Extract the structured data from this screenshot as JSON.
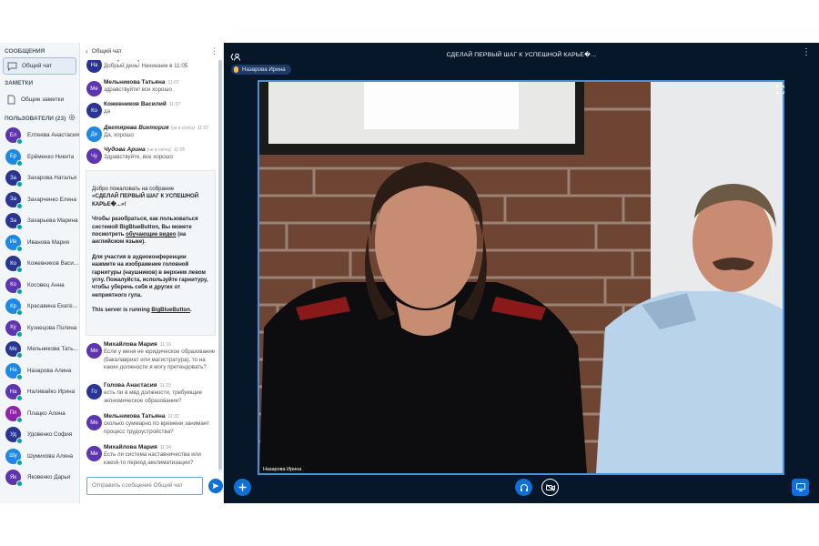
{
  "sidebar": {
    "messages_heading": "СООБЩЕНИЯ",
    "public_chat_label": "Общий чат",
    "notes_heading": "ЗАМЕТКИ",
    "shared_notes_label": "Общие заметки",
    "users_heading": "ПОЛЬЗОВАТЕЛИ (23)",
    "users": [
      {
        "initials": "Ел",
        "name": "Елтеева Анастасия",
        "color": "#5e35b1"
      },
      {
        "initials": "Ер",
        "name": "Ерёменко Никита",
        "color": "#1e88e5"
      },
      {
        "initials": "За",
        "name": "Захарова Наталья",
        "color": "#283593"
      },
      {
        "initials": "За",
        "name": "Захарченко Елена",
        "color": "#283593"
      },
      {
        "initials": "За",
        "name": "Захарьева Марина",
        "color": "#283593"
      },
      {
        "initials": "Ив",
        "name": "Иванова Мария",
        "color": "#1e88e5"
      },
      {
        "initials": "Ко",
        "name": "Кожевников Васи...",
        "color": "#283593"
      },
      {
        "initials": "Ко",
        "name": "Косовец Анна",
        "color": "#5e35b1"
      },
      {
        "initials": "Кр",
        "name": "Красавина Екате...",
        "color": "#1e88e5"
      },
      {
        "initials": "Ку",
        "name": "Кузнецова Полина",
        "color": "#5e35b1"
      },
      {
        "initials": "Ме",
        "name": "Мельникова Тать...",
        "color": "#283593"
      },
      {
        "initials": "На",
        "name": "Назарова Алина",
        "color": "#1e88e5"
      },
      {
        "initials": "На",
        "name": "Наливайко Ирина",
        "color": "#5e35b1"
      },
      {
        "initials": "Пл",
        "name": "Плацко Алина",
        "color": "#8e24aa"
      },
      {
        "initials": "Уд",
        "name": "Удовенко София",
        "color": "#283593"
      },
      {
        "initials": "Шу",
        "name": "Шумихова Алина",
        "color": "#1e88e5"
      },
      {
        "initials": "Як",
        "name": "Яковенко Дарья",
        "color": "#5e35b1"
      }
    ]
  },
  "chat": {
    "title": "Общий чат",
    "messages_top": [
      {
        "initials": "На",
        "name": "Назарова Ирина",
        "time": "11:01",
        "text": "Добрый день! Начинаем в 11:05",
        "offline": false,
        "color": "#283593"
      },
      {
        "initials": "Ме",
        "name": "Мельникова Татьяна",
        "time": "11:07",
        "text": "здравствуйте! все хорошо",
        "offline": false,
        "color": "#5e35b1"
      },
      {
        "initials": "Ко",
        "name": "Кожевников Василий",
        "time": "11:07",
        "text": "да",
        "offline": false,
        "color": "#283593"
      },
      {
        "initials": "Де",
        "name": "Дегтярева Виктория",
        "tag": "(не в сети)",
        "time": "11:07",
        "text": "Да, хорошо",
        "offline": true,
        "color": "#1e88e5"
      },
      {
        "initials": "Чу",
        "name": "Чудова Арина",
        "tag": "(не в сети)",
        "time": "11:05",
        "text": "Здравствуйте, все хорошо",
        "offline": true,
        "color": "#5e35b1"
      }
    ],
    "welcome": {
      "line1": "Добро пожаловать на собрание",
      "line2": "«СДЕЛАЙ ПЕРВЫЙ ШАГ К УСПЕШНОЙ КАРЬЕ�...»!",
      "p2_a": "Чтобы разобраться, как пользоваться системой BigBlueButton, Вы можете посмотреть ",
      "p2_link": "обучающие видео",
      "p2_b": " (на английском языке).",
      "p3": "Для участия в аудиоконференции нажмите на изображение головной гарнитуры (наушников) в верхнем левом углу. Пожалуйста, используйте гарнитуру, чтобы уберечь себя и других от неприятного гула.",
      "p4_a": "This server is running ",
      "p4_link": "BigBlueButton",
      "p4_b": "."
    },
    "messages_bottom": [
      {
        "initials": "Ми",
        "name": "Михайлова Мария",
        "time": "11:16",
        "text": "Если у меня не юридическое образование (бакалавриат или магистратура), то на какие должности я могу претендовать?",
        "color": "#5e35b1"
      },
      {
        "initials": "Го",
        "name": "Голова Анастасия",
        "time": "11:23",
        "text": "есть ли в мвд должности, требующие экономическое образование?",
        "color": "#283593"
      },
      {
        "initials": "Ме",
        "name": "Мельникова Татьяна",
        "time": "11:32",
        "text": "сколько суммарно по времени занимает процесс трудоустройства?",
        "color": "#5e35b1"
      },
      {
        "initials": "Ми",
        "name": "Михайлова Мария",
        "time": "11:34",
        "text": "Есть ли система наставничества или какой-то период акклиматизации?",
        "color": "#5e35b1"
      }
    ],
    "input_placeholder": "Отправить сообщение Общий чат"
  },
  "main": {
    "title": "СДЕЛАЙ ПЕРВЫЙ ШАГ К УСПЕШНОЙ КАРЬЕ�...",
    "presenter": "Назарова Ирина",
    "video_label": "Назарова Ирина",
    "accent": "#0f70d7"
  }
}
